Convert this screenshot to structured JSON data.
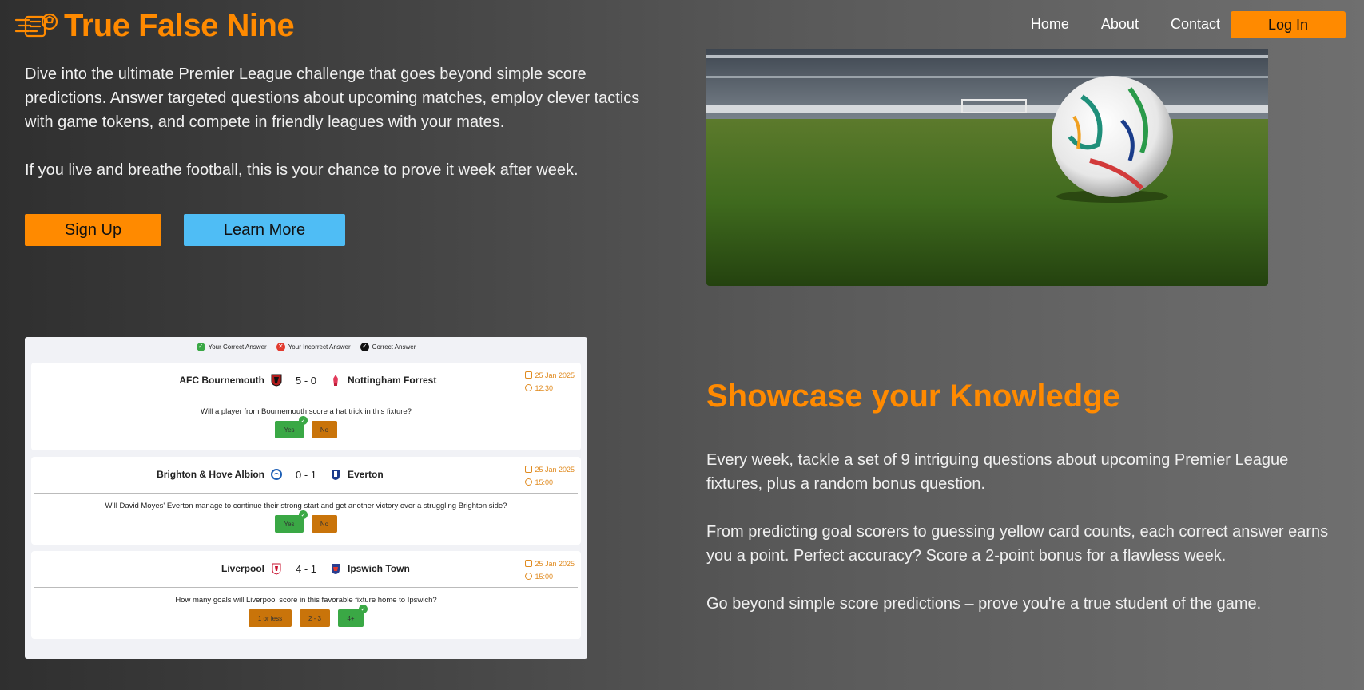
{
  "brand": {
    "name": "True False Nine",
    "accent": "#ff8a00",
    "logo_icon": "football-speed-icon"
  },
  "nav": {
    "links": [
      "Home",
      "About",
      "Contact"
    ],
    "login_label": "Log In"
  },
  "intro": {
    "paragraphs": [
      "Dive into the ultimate Premier League challenge that goes beyond simple score predictions. Answer targeted questions about upcoming matches, employ clever tactics with game tokens, and compete in friendly leagues with your mates.",
      "If you live and breathe football, this is your chance to prove it week after week."
    ],
    "signup_label": "Sign Up",
    "learn_label": "Learn More"
  },
  "hero_image": {
    "subject": "football on stadium pitch"
  },
  "preview": {
    "legend": [
      "Your Correct Answer",
      "Your Incorrect Answer",
      "Correct Answer"
    ],
    "fixtures": [
      {
        "home": "AFC Bournemouth",
        "score": "5 - 0",
        "away": "Nottingham Forrest",
        "date": "25 Jan 2025",
        "time": "12:30",
        "question": "Will a player from Bournemouth score a hat trick in this fixture?",
        "answers": [
          "Yes",
          "No"
        ]
      },
      {
        "home": "Brighton & Hove Albion",
        "score": "0 - 1",
        "away": "Everton",
        "date": "25 Jan 2025",
        "time": "15:00",
        "question": "Will David Moyes' Everton manage to continue their strong start and get another victory over a struggling Brighton side?",
        "answers": [
          "Yes",
          "No"
        ]
      },
      {
        "home": "Liverpool",
        "score": "4 - 1",
        "away": "Ipswich Town",
        "date": "25 Jan 2025",
        "time": "15:00",
        "question": "How many goals will Liverpool score in this favorable fixture home to Ipswich?",
        "answers": [
          "1 or less",
          "2 - 3",
          "4+"
        ]
      }
    ]
  },
  "showcase": {
    "title": "Showcase your Knowledge",
    "paragraphs": [
      "Every week, tackle a set of 9 intriguing questions about upcoming Premier League fixtures, plus a random bonus question.",
      "From predicting goal scorers to guessing yellow card counts, each correct answer earns you a point. Perfect accuracy? Score a 2-point bonus for a flawless week.",
      "Go beyond simple score predictions – prove you're a true student of the game."
    ]
  },
  "colors": {
    "correct": "#3aa845",
    "incorrect": "#e23a2e",
    "answer_default": "#c9740a",
    "learn_more": "#4fbdf5"
  }
}
